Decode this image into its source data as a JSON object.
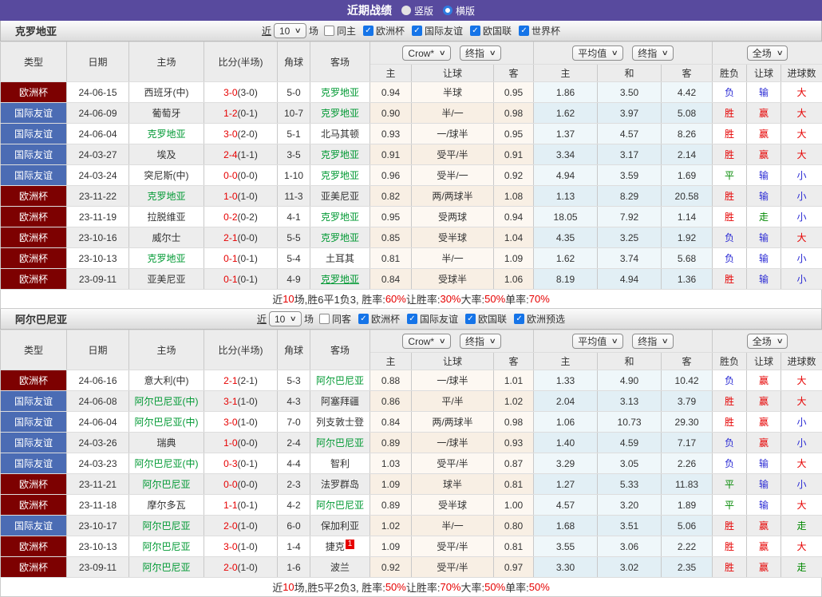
{
  "title_bar": {
    "title": "近期战绩",
    "vertical": "竖版",
    "horizontal": "横版"
  },
  "filter_labels": {
    "near": "近",
    "count": "10",
    "games": "场"
  },
  "table_head": {
    "cols": [
      "类型",
      "日期",
      "主场",
      "比分(半场)",
      "角球",
      "客场"
    ],
    "dropdown_company": "Crow*",
    "dropdown_final1": "终指",
    "dropdown_avg": "平均值",
    "dropdown_final2": "终指",
    "dropdown_scope": "全场",
    "sub": [
      "主",
      "让球",
      "客",
      "主",
      "和",
      "客",
      "胜负",
      "让球",
      "进球数"
    ]
  },
  "colors": {
    "titlebar": "#584a9e",
    "focus_team": "#009933",
    "score": "#e60000",
    "league": {
      "欧洲杯": "#7d0101",
      "国际友谊": "#4b6cb4"
    },
    "result": {
      "胜": "#e60000",
      "赢": "#e60000",
      "大": "#e60000",
      "负": "#2a2ad4",
      "输": "#2a2ad4",
      "小": "#2a2ad4",
      "平": "#008800",
      "走": "#008800"
    }
  },
  "sections": [
    {
      "team": "克罗地亚",
      "filter": {
        "same": "同主",
        "same_checked": false,
        "leagues": [
          "欧洲杯",
          "国际友谊",
          "欧国联",
          "世界杯"
        ]
      },
      "rows": [
        {
          "league": "欧洲杯",
          "date": "24-06-15",
          "home": "西班牙(中)",
          "home_focus": false,
          "score": "3-0",
          "half": "(3-0)",
          "corners": "5-0",
          "away": "克罗地亚",
          "away_focus": true,
          "odds": [
            "0.94",
            "半球",
            "0.95"
          ],
          "avg": [
            "1.86",
            "3.50",
            "4.42"
          ],
          "results": [
            "负",
            "输",
            "大"
          ]
        },
        {
          "league": "国际友谊",
          "date": "24-06-09",
          "home": "葡萄牙",
          "home_focus": false,
          "score": "1-2",
          "half": "(0-1)",
          "corners": "10-7",
          "away": "克罗地亚",
          "away_focus": true,
          "odds": [
            "0.90",
            "半/一",
            "0.98"
          ],
          "avg": [
            "1.62",
            "3.97",
            "5.08"
          ],
          "results": [
            "胜",
            "赢",
            "大"
          ]
        },
        {
          "league": "国际友谊",
          "date": "24-06-04",
          "home": "克罗地亚",
          "home_focus": true,
          "score": "3-0",
          "half": "(2-0)",
          "corners": "5-1",
          "away": "北马其顿",
          "away_focus": false,
          "odds": [
            "0.93",
            "一/球半",
            "0.95"
          ],
          "avg": [
            "1.37",
            "4.57",
            "8.26"
          ],
          "results": [
            "胜",
            "赢",
            "大"
          ]
        },
        {
          "league": "国际友谊",
          "date": "24-03-27",
          "home": "埃及",
          "home_focus": false,
          "score": "2-4",
          "half": "(1-1)",
          "corners": "3-5",
          "away": "克罗地亚",
          "away_focus": true,
          "odds": [
            "0.91",
            "受平/半",
            "0.91"
          ],
          "avg": [
            "3.34",
            "3.17",
            "2.14"
          ],
          "results": [
            "胜",
            "赢",
            "大"
          ]
        },
        {
          "league": "国际友谊",
          "date": "24-03-24",
          "home": "突尼斯(中)",
          "home_focus": false,
          "score": "0-0",
          "half": "(0-0)",
          "corners": "1-10",
          "away": "克罗地亚",
          "away_focus": true,
          "odds": [
            "0.96",
            "受半/一",
            "0.92"
          ],
          "avg": [
            "4.94",
            "3.59",
            "1.69"
          ],
          "results": [
            "平",
            "输",
            "小"
          ]
        },
        {
          "league": "欧洲杯",
          "date": "23-11-22",
          "home": "克罗地亚",
          "home_focus": true,
          "score": "1-0",
          "half": "(1-0)",
          "corners": "11-3",
          "away": "亚美尼亚",
          "away_focus": false,
          "odds": [
            "0.82",
            "两/两球半",
            "1.08"
          ],
          "avg": [
            "1.13",
            "8.29",
            "20.58"
          ],
          "results": [
            "胜",
            "输",
            "小"
          ]
        },
        {
          "league": "欧洲杯",
          "date": "23-11-19",
          "home": "拉脱维亚",
          "home_focus": false,
          "score": "0-2",
          "half": "(0-2)",
          "corners": "4-1",
          "away": "克罗地亚",
          "away_focus": true,
          "odds": [
            "0.95",
            "受两球",
            "0.94"
          ],
          "avg": [
            "18.05",
            "7.92",
            "1.14"
          ],
          "results": [
            "胜",
            "走",
            "小"
          ]
        },
        {
          "league": "欧洲杯",
          "date": "23-10-16",
          "home": "威尔士",
          "home_focus": false,
          "score": "2-1",
          "half": "(0-0)",
          "corners": "5-5",
          "away": "克罗地亚",
          "away_focus": true,
          "odds": [
            "0.85",
            "受半球",
            "1.04"
          ],
          "avg": [
            "4.35",
            "3.25",
            "1.92"
          ],
          "results": [
            "负",
            "输",
            "大"
          ]
        },
        {
          "league": "欧洲杯",
          "date": "23-10-13",
          "home": "克罗地亚",
          "home_focus": true,
          "score": "0-1",
          "half": "(0-1)",
          "corners": "5-4",
          "away": "土耳其",
          "away_focus": false,
          "odds": [
            "0.81",
            "半/一",
            "1.09"
          ],
          "avg": [
            "1.62",
            "3.74",
            "5.68"
          ],
          "results": [
            "负",
            "输",
            "小"
          ]
        },
        {
          "league": "欧洲杯",
          "date": "23-09-11",
          "home": "亚美尼亚",
          "home_focus": false,
          "score": "0-1",
          "half": "(0-1)",
          "corners": "4-9",
          "away": "克罗地亚",
          "away_focus": true,
          "away_underline": true,
          "odds": [
            "0.84",
            "受球半",
            "1.06"
          ],
          "avg": [
            "8.19",
            "4.94",
            "1.36"
          ],
          "results": [
            "胜",
            "输",
            "小"
          ]
        }
      ],
      "summary": [
        {
          "t": "近",
          "r": false
        },
        {
          "t": "10",
          "r": true
        },
        {
          "t": "场,胜6平1负3, 胜率:",
          "r": false
        },
        {
          "t": "60%",
          "r": true
        },
        {
          "t": " 让胜率:",
          "r": false
        },
        {
          "t": "30%",
          "r": true
        },
        {
          "t": " 大率:",
          "r": false
        },
        {
          "t": "50%",
          "r": true
        },
        {
          "t": " 单率:",
          "r": false
        },
        {
          "t": "70%",
          "r": true
        }
      ]
    },
    {
      "team": "阿尔巴尼亚",
      "filter": {
        "same": "同客",
        "same_checked": false,
        "leagues": [
          "欧洲杯",
          "国际友谊",
          "欧国联",
          "欧洲预选"
        ]
      },
      "rows": [
        {
          "league": "欧洲杯",
          "date": "24-06-16",
          "home": "意大利(中)",
          "home_focus": false,
          "score": "2-1",
          "half": "(2-1)",
          "corners": "5-3",
          "away": "阿尔巴尼亚",
          "away_focus": true,
          "odds": [
            "0.88",
            "一/球半",
            "1.01"
          ],
          "avg": [
            "1.33",
            "4.90",
            "10.42"
          ],
          "results": [
            "负",
            "赢",
            "大"
          ]
        },
        {
          "league": "国际友谊",
          "date": "24-06-08",
          "home": "阿尔巴尼亚(中)",
          "home_focus": true,
          "score": "3-1",
          "half": "(1-0)",
          "corners": "4-3",
          "away": "阿塞拜疆",
          "away_focus": false,
          "odds": [
            "0.86",
            "平/半",
            "1.02"
          ],
          "avg": [
            "2.04",
            "3.13",
            "3.79"
          ],
          "results": [
            "胜",
            "赢",
            "大"
          ]
        },
        {
          "league": "国际友谊",
          "date": "24-06-04",
          "home": "阿尔巴尼亚(中)",
          "home_focus": true,
          "score": "3-0",
          "half": "(1-0)",
          "corners": "7-0",
          "away": "列支敦士登",
          "away_focus": false,
          "odds": [
            "0.84",
            "两/两球半",
            "0.98"
          ],
          "avg": [
            "1.06",
            "10.73",
            "29.30"
          ],
          "results": [
            "胜",
            "赢",
            "小"
          ]
        },
        {
          "league": "国际友谊",
          "date": "24-03-26",
          "home": "瑞典",
          "home_focus": false,
          "score": "1-0",
          "half": "(0-0)",
          "corners": "2-4",
          "away": "阿尔巴尼亚",
          "away_focus": true,
          "odds": [
            "0.89",
            "一/球半",
            "0.93"
          ],
          "avg": [
            "1.40",
            "4.59",
            "7.17"
          ],
          "results": [
            "负",
            "赢",
            "小"
          ]
        },
        {
          "league": "国际友谊",
          "date": "24-03-23",
          "home": "阿尔巴尼亚(中)",
          "home_focus": true,
          "score": "0-3",
          "half": "(0-1)",
          "corners": "4-4",
          "away": "智利",
          "away_focus": false,
          "odds": [
            "1.03",
            "受平/半",
            "0.87"
          ],
          "avg": [
            "3.29",
            "3.05",
            "2.26"
          ],
          "results": [
            "负",
            "输",
            "大"
          ]
        },
        {
          "league": "欧洲杯",
          "date": "23-11-21",
          "home": "阿尔巴尼亚",
          "home_focus": true,
          "score": "0-0",
          "half": "(0-0)",
          "corners": "2-3",
          "away": "法罗群岛",
          "away_focus": false,
          "odds": [
            "1.09",
            "球半",
            "0.81"
          ],
          "avg": [
            "1.27",
            "5.33",
            "11.83"
          ],
          "results": [
            "平",
            "输",
            "小"
          ]
        },
        {
          "league": "欧洲杯",
          "date": "23-11-18",
          "home": "摩尔多瓦",
          "home_focus": false,
          "score": "1-1",
          "half": "(0-1)",
          "corners": "4-2",
          "away": "阿尔巴尼亚",
          "away_focus": true,
          "odds": [
            "0.89",
            "受半球",
            "1.00"
          ],
          "avg": [
            "4.57",
            "3.20",
            "1.89"
          ],
          "results": [
            "平",
            "输",
            "大"
          ]
        },
        {
          "league": "国际友谊",
          "date": "23-10-17",
          "home": "阿尔巴尼亚",
          "home_focus": true,
          "score": "2-0",
          "half": "(1-0)",
          "corners": "6-0",
          "away": "保加利亚",
          "away_focus": false,
          "odds": [
            "1.02",
            "半/一",
            "0.80"
          ],
          "avg": [
            "1.68",
            "3.51",
            "5.06"
          ],
          "results": [
            "胜",
            "赢",
            "走"
          ]
        },
        {
          "league": "欧洲杯",
          "date": "23-10-13",
          "home": "阿尔巴尼亚",
          "home_focus": true,
          "score": "3-0",
          "half": "(1-0)",
          "corners": "1-4",
          "away": "捷克",
          "away_badge": "1",
          "away_focus": false,
          "odds": [
            "1.09",
            "受平/半",
            "0.81"
          ],
          "avg": [
            "3.55",
            "3.06",
            "2.22"
          ],
          "results": [
            "胜",
            "赢",
            "大"
          ]
        },
        {
          "league": "欧洲杯",
          "date": "23-09-11",
          "home": "阿尔巴尼亚",
          "home_focus": true,
          "score": "2-0",
          "half": "(1-0)",
          "corners": "1-6",
          "away": "波兰",
          "away_focus": false,
          "odds": [
            "0.92",
            "受平/半",
            "0.97"
          ],
          "avg": [
            "3.30",
            "3.02",
            "2.35"
          ],
          "results": [
            "胜",
            "赢",
            "走"
          ]
        }
      ],
      "summary": [
        {
          "t": "近",
          "r": false
        },
        {
          "t": "10",
          "r": true
        },
        {
          "t": "场,胜5平2负3, 胜率:",
          "r": false
        },
        {
          "t": "50%",
          "r": true
        },
        {
          "t": " 让胜率:",
          "r": false
        },
        {
          "t": "70%",
          "r": true
        },
        {
          "t": " 大率:",
          "r": false
        },
        {
          "t": "50%",
          "r": true
        },
        {
          "t": " 单率:",
          "r": false
        },
        {
          "t": "50%",
          "r": true
        }
      ]
    }
  ]
}
